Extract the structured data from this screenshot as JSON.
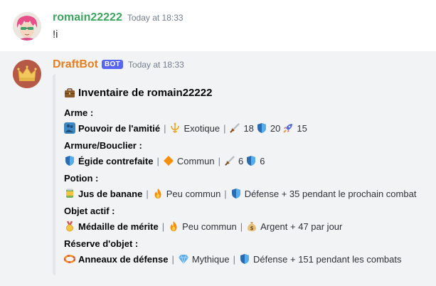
{
  "messages": [
    {
      "username": "romain22222",
      "timestamp": "Today at 18:33",
      "content": "!i"
    },
    {
      "username": "DraftBot",
      "bot_tag": "BOT",
      "timestamp": "Today at 18:33"
    }
  ],
  "embed": {
    "title": "Inventaire de romain22222",
    "title_icon": "briefcase-icon",
    "fields": [
      {
        "name": "Arme :",
        "item_icon": "people-hugging-icon",
        "item": "Pouvoir de l'amitié",
        "rarity_icon": "trident-emblem-icon",
        "rarity": "Exotique",
        "stats": [
          {
            "icon": "dagger-icon",
            "value": "18"
          },
          {
            "icon": "shield-icon",
            "value": "20"
          },
          {
            "icon": "rocket-icon",
            "value": "15"
          }
        ]
      },
      {
        "name": "Armure/Bouclier :",
        "item_icon": "shield-icon",
        "item": "Égide contrefaite",
        "rarity_icon": "orange-diamond-icon",
        "rarity": "Commun",
        "stats": [
          {
            "icon": "dagger-icon",
            "value": "6"
          },
          {
            "icon": "shield-icon",
            "value": "6"
          }
        ]
      },
      {
        "name": "Potion :",
        "item_icon": "canned-food-icon",
        "item": "Jus de banane",
        "rarity_icon": "fire-icon",
        "rarity": "Peu commun",
        "effect_icon": "shield-icon",
        "effect": "Défense + 35 pendant le prochain combat"
      },
      {
        "name": "Objet actif :",
        "item_icon": "medal-icon",
        "item": "Médaille de mérite",
        "rarity_icon": "fire-icon",
        "rarity": "Peu commun",
        "effect_icon": "money-bag-icon",
        "effect": "Argent + 47 par jour"
      },
      {
        "name": "Réserve d'objet :",
        "item_icon": "ring-buoy-icon",
        "item": "Anneaux de défense",
        "rarity_icon": "gem-icon",
        "rarity": "Mythique",
        "effect_icon": "shield-icon",
        "effect": "Défense + 151 pendant les combats"
      }
    ],
    "separator": "|"
  },
  "colors": {
    "user_green": "#3ba55d",
    "bot_orange": "#e67e22",
    "bot_tag": "#5865f2"
  }
}
